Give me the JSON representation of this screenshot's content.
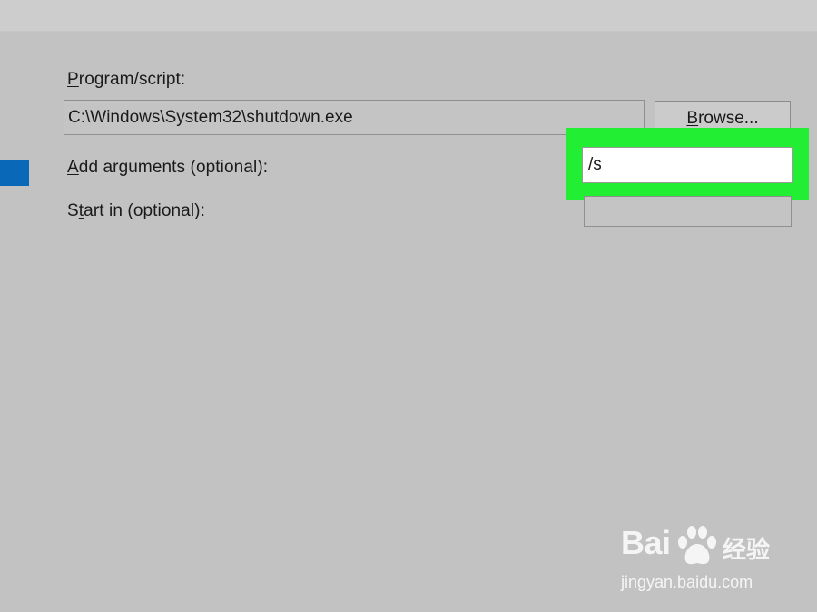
{
  "form": {
    "program_label_accel": "P",
    "program_label_rest": "rogram/script:",
    "program_value": "C:\\Windows\\System32\\shutdown.exe",
    "browse_label_accel": "B",
    "browse_label_rest": "rowse...",
    "arguments_label_accel": "A",
    "arguments_label_rest": "dd arguments (optional):",
    "arguments_value": "/s",
    "start_label_pre": "S",
    "start_label_accel": "t",
    "start_label_rest": "art in (optional):",
    "start_value": ""
  },
  "watermark": {
    "logo_left": "Bai",
    "logo_right": "经验",
    "url": "jingyan.baidu.com"
  },
  "colors": {
    "background": "#c2c2c2",
    "highlight": "#22ee33",
    "accent": "#0a68b8"
  }
}
